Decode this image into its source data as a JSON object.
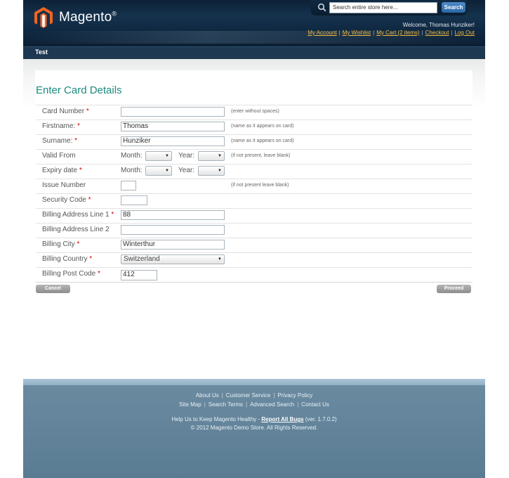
{
  "header": {
    "logo_text": "Magento",
    "logo_mark": "®",
    "search_placeholder": "Search entire store here...",
    "search_button": "Search",
    "welcome": "Welcome, Thomas Hunziker!",
    "links": [
      "My Account",
      "My Wishlist",
      "My Cart (2 items)",
      "Checkout",
      "Log Out"
    ]
  },
  "nav": {
    "items": [
      "Test"
    ]
  },
  "page": {
    "title": "Enter Card Details"
  },
  "form": {
    "card_number": {
      "label": "Card Number",
      "required": "*",
      "value": "",
      "hint": "(enter without spaces)"
    },
    "firstname": {
      "label": "Firstname:",
      "required": "*",
      "value": "Thomas",
      "hint": "(name as it appears on card)"
    },
    "surname": {
      "label": "Surname:",
      "required": "*",
      "value": "Hunziker",
      "hint": "(name as it appears on card)"
    },
    "valid_from": {
      "label": "Valid From",
      "month_label": "Month:",
      "year_label": "Year:",
      "month": "",
      "year": "",
      "hint": "(if not present, leave blank)"
    },
    "expiry_date": {
      "label": "Expiry date",
      "required": "*",
      "month_label": "Month:",
      "year_label": "Year:",
      "month": "",
      "year": ""
    },
    "issue_number": {
      "label": "Issue Number",
      "value": "",
      "hint": "(if not present leave blank)"
    },
    "security_code": {
      "label": "Security Code",
      "required": "*",
      "value": ""
    },
    "billing_address_1": {
      "label": "Billing Address Line 1",
      "required": "*",
      "value": "88"
    },
    "billing_address_2": {
      "label": "Billing Address Line 2",
      "value": ""
    },
    "billing_city": {
      "label": "Billing City",
      "required": "*",
      "value": "Winterthur"
    },
    "billing_country": {
      "label": "Billing Country",
      "required": "*",
      "value": "Switzerland"
    },
    "billing_post_code": {
      "label": "Billing Post Code",
      "required": "*",
      "value": "412"
    }
  },
  "buttons": {
    "cancel": "Cancel",
    "proceed": "Proceed"
  },
  "footer": {
    "links_row1": [
      "About Us",
      "Customer Service",
      "Privacy Policy"
    ],
    "links_row2": [
      "Site Map",
      "Search Terms",
      "Advanced Search",
      "Contact Us"
    ],
    "help_prefix": "Help Us to Keep Magento Healthy - ",
    "help_link": "Report All Bugs",
    "help_suffix": " (ver. 1.7.0.2)",
    "copyright": "© 2012 Magento Demo Store. All Rights Reserved."
  },
  "colors": {
    "header_bg": "#15324d",
    "title": "#1a8a7e",
    "required": "#d40000",
    "link": "#f0b840",
    "footer_bg": "#5a7c93"
  }
}
